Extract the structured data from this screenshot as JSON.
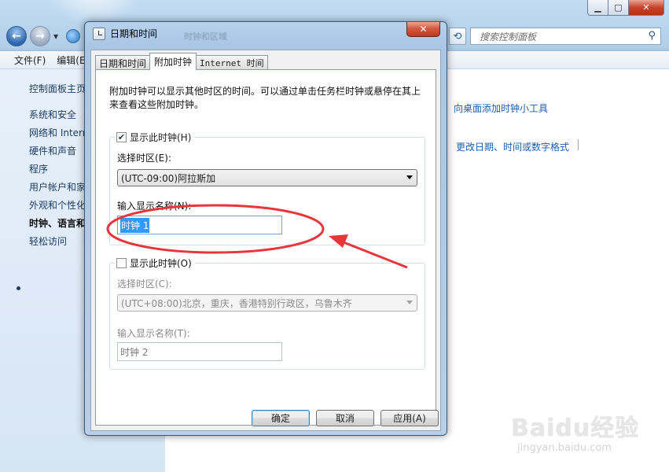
{
  "background_window": {
    "search_placeholder": "搜索控制面板",
    "menu": [
      "文件(F)",
      "编辑(E"
    ],
    "left_nav": [
      "控制面板主页",
      "系统和安全",
      "网络和 Intern",
      "硬件和声音",
      "程序",
      "用户帐户和家",
      "外观和个性化",
      "时钟、语言和",
      "轻松访问"
    ],
    "active_nav_index": 7,
    "links": {
      "add_gadget": "向桌面添加时钟小工具",
      "change_format": "更改日期、时间或数字格式"
    },
    "blurred_path": "时钟和区域"
  },
  "dialog": {
    "title": "日期和时间",
    "close_symbol": "✕",
    "tabs": [
      "日期和时间",
      "附加时钟",
      "Internet 时间"
    ],
    "selected_tab_index": 1,
    "intro": "附加时钟可以显示其他时区的时间。可以通过单击任务栏时钟或悬停在其上来查看这些附加时钟。",
    "clock1": {
      "checkbox_label": "显示此时钟(H)",
      "checked": true,
      "timezone_label": "选择时区(E):",
      "timezone_value": "(UTC-09:00)阿拉斯加",
      "name_label": "输入显示名称(N):",
      "name_value": "时钟 1"
    },
    "clock2": {
      "checkbox_label": "显示此时钟(O)",
      "checked": false,
      "timezone_label": "选择时区(C):",
      "timezone_value": "(UTC+08:00)北京，重庆，香港特别行政区，乌鲁木齐",
      "name_label": "输入显示名称(T):",
      "name_value": "时钟 2"
    },
    "buttons": {
      "ok": "确定",
      "cancel": "取消",
      "apply": "应用(A)"
    }
  },
  "annotation_color": "#e8353a",
  "watermark": {
    "main": "Baidu经验",
    "sub": "jingyan.baidu.com"
  }
}
